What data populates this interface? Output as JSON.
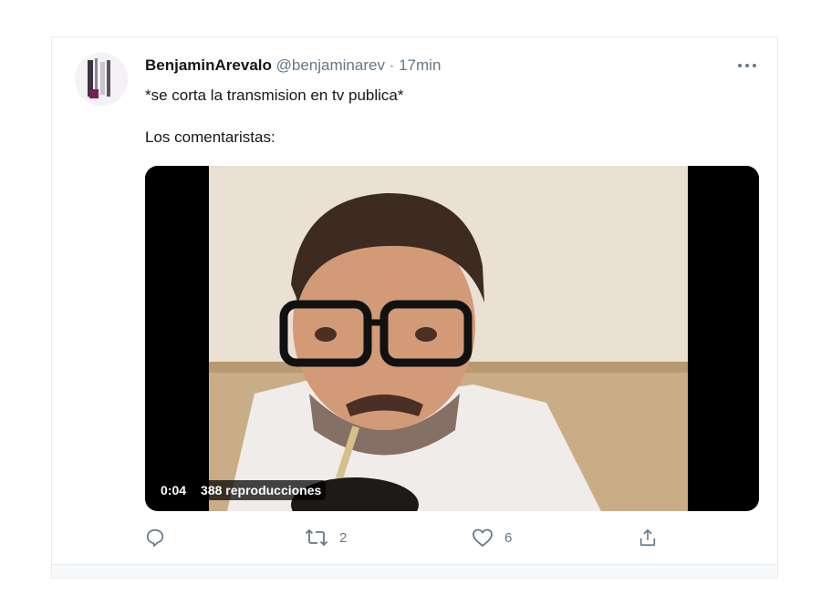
{
  "tweet": {
    "display_name": "BenjaminArevalo",
    "handle": "@benjaminarev",
    "separator": "·",
    "time": "17min",
    "text_line1": "*se corta la transmision en tv publica*",
    "text_line2": "Los comentaristas:"
  },
  "video": {
    "duration": "0:04",
    "views": "388 reproducciones"
  },
  "actions": {
    "reply_count": "",
    "retweet_count": "2",
    "like_count": "6"
  },
  "colors": {
    "text_primary": "#14171a",
    "text_secondary": "#657786",
    "border": "#e6ecf0"
  },
  "icons": [
    "more-icon",
    "reply-icon",
    "retweet-icon",
    "like-icon",
    "share-icon"
  ]
}
